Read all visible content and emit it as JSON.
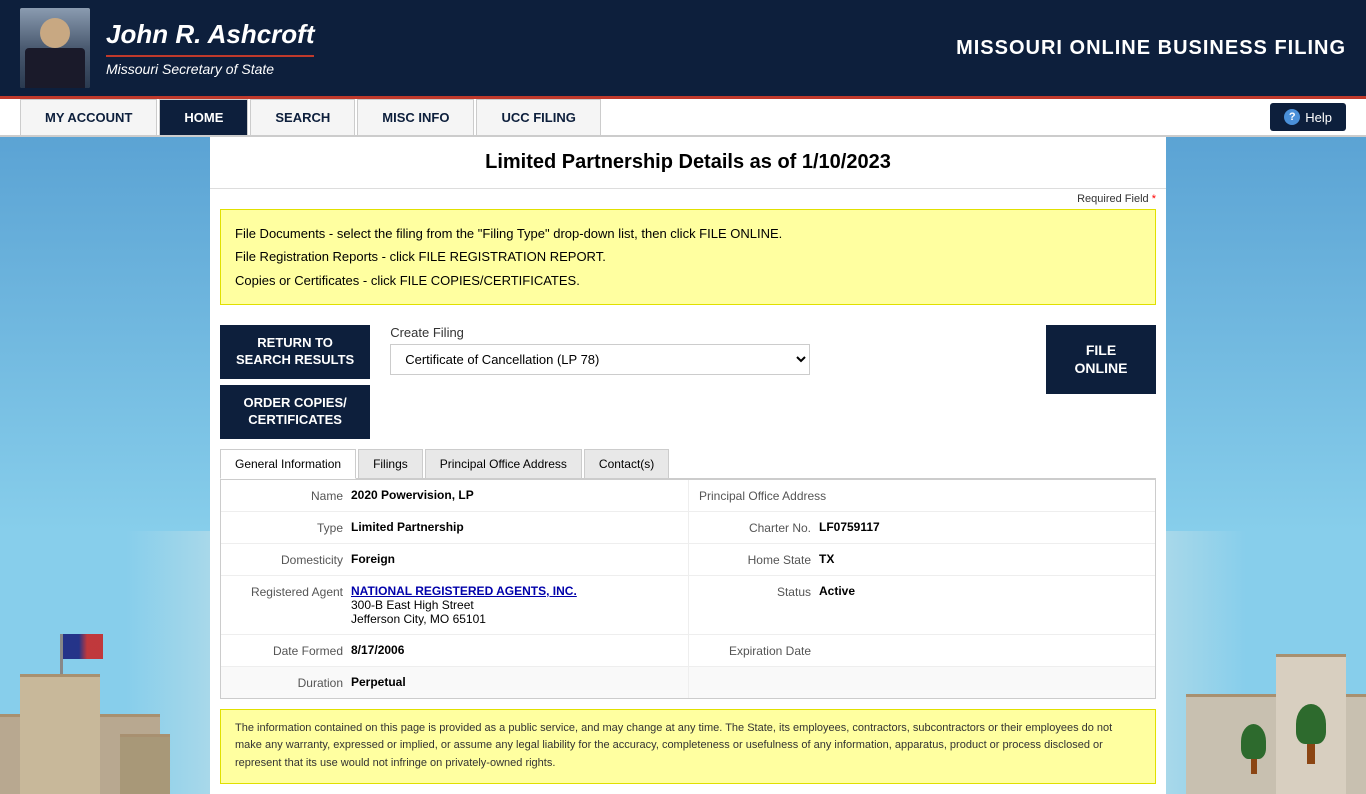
{
  "header": {
    "name": "John R. Ashcroft",
    "subtitle": "Missouri Secretary of State",
    "site_title": "MISSOURI ONLINE BUSINESS FILING"
  },
  "navbar": {
    "items": [
      {
        "label": "MY ACCOUNT",
        "active": false
      },
      {
        "label": "HOME",
        "active": true
      },
      {
        "label": "SEARCH",
        "active": false
      },
      {
        "label": "MISC INFO",
        "active": false
      },
      {
        "label": "UCC FILING",
        "active": false
      }
    ],
    "help_label": "Help"
  },
  "page": {
    "title": "Limited Partnership Details as of 1/10/2023",
    "required_field_label": "Required Field"
  },
  "info_box": {
    "line1": "File Documents - select the filing from the \"Filing Type\" drop-down list, then click FILE ONLINE.",
    "line2": "File Registration Reports - click FILE REGISTRATION REPORT.",
    "line3": "Copies or Certificates - click FILE COPIES/CERTIFICATES."
  },
  "actions": {
    "return_to_search": "RETURN TO\nSEARCH RESULTS",
    "return_line1": "RETURN TO",
    "return_line2": "SEARCH RESULTS",
    "order_copies_line1": "ORDER COPIES/",
    "order_copies_line2": "CERTIFICATES",
    "create_filing_label": "Create Filing",
    "filing_option": "Certificate of Cancellation (LP 78)",
    "file_online_line1": "FILE",
    "file_online_line2": "ONLINE"
  },
  "tabs": [
    {
      "label": "General Information",
      "active": true
    },
    {
      "label": "Filings",
      "active": false
    },
    {
      "label": "Principal Office Address",
      "active": false
    },
    {
      "label": "Contact(s)",
      "active": false
    }
  ],
  "details": {
    "name_label": "Name",
    "name_value": "2020 Powervision, LP",
    "principal_office_label": "Principal Office Address",
    "type_label": "Type",
    "type_value": "Limited Partnership",
    "charter_no_label": "Charter No.",
    "charter_no_value": "LF0759117",
    "domesticity_label": "Domesticity",
    "domesticity_value": "Foreign",
    "home_state_label": "Home State",
    "home_state_value": "TX",
    "registered_agent_label": "Registered Agent",
    "registered_agent_value": "NATIONAL REGISTERED AGENTS, INC.",
    "registered_agent_address1": "300-B East High Street",
    "registered_agent_address2": "Jefferson City, MO 65101",
    "status_label": "Status",
    "status_value": "Active",
    "date_formed_label": "Date Formed",
    "date_formed_value": "8/17/2006",
    "expiration_date_label": "Expiration Date",
    "expiration_date_value": "",
    "duration_label": "Duration",
    "duration_value": "Perpetual"
  },
  "disclaimer": "The information contained on this page is provided as a public service, and may change at any time. The State, its employees, contractors, subcontractors or their employees do not make any warranty, expressed or implied, or assume any legal liability for the accuracy, completeness or usefulness of any information, apparatus, product or process disclosed or represent that its use would not infringe on privately-owned rights."
}
